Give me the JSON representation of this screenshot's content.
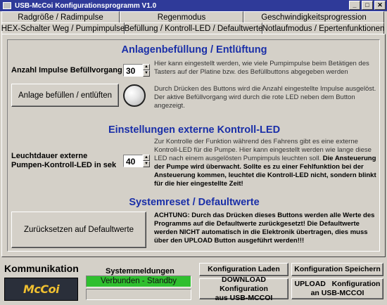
{
  "window": {
    "title": "USB-McCoi Konfigurationsprogramm V1.0"
  },
  "tabs_row1": [
    "Radgröße / Radimpulse",
    "Regenmodus",
    "Geschwindigkeitsprogression"
  ],
  "tabs_row2": [
    "HEX-Schalter Weg / Pumpimpulse",
    "Befüllung / Kontroll-LED / Defaultwerte",
    "Notlaufmodus / Epertenfunktionen"
  ],
  "section1": {
    "title": "Anlagenbefüllung / Entlüftung",
    "impulse_label": "Anzahl Impulse Befüllvorgang",
    "impulse_value": "30",
    "impulse_desc": "Hier kann eingestellt werden, wie viele Pumpimpulse beim Betätigen des Tasters auf der Platine bzw. des Befüllbuttons abgegeben werden",
    "fill_button": "Anlage befüllen / entlüften",
    "fill_desc": "Durch Drücken des Buttons wird die Anzahl eingestellte Impulse ausgelöst. Der aktive Befüllvorgang wird durch die rote LED neben dem Button angezeigt."
  },
  "section2": {
    "title": "Einstellungen externe Kontroll-LED",
    "label_line1": "Leuchtdauer externe",
    "label_line2": "Pumpen-Kontroll-LED in sek",
    "value": "40",
    "desc_normal": "Zur Kontrolle der Funktion während des Fahrens gibt es eine externe Kontroll-LED für die Pumpe. Hier kann eingestellt werden wie lange diese LED nach einem ausgelösten Pumpimpuls leuchten soll.",
    "desc_bold": "Die Ansteuerung der Pumpe wird überwacht. Sollte es zu einer Fehlfunktion bei der Ansteuerung kommen, leuchtet die Kontroll-LED nicht, sondern blinkt für die hier eingestellte Zeit!"
  },
  "section3": {
    "title": "Systemreset / Defaultwerte",
    "reset_button": "Zurücksetzen auf Defaultwerte",
    "warning": "ACHTUNG: Durch das Drücken dieses Buttons werden alle Werte des Programms auf die Defaultwerte zurückgesetzt! Die Defaultwerte werden NICHT automatisch in die Elektronik übertragen, dies muss über den UPLOAD Button ausgeführt werden!!!"
  },
  "footer": {
    "kommunikation": "Kommunikation",
    "logo_text": "McCoi",
    "systemmeldungen": "Systemmeldungen",
    "status": "Verbunden - Standby",
    "btn_load": "Konfiguration Laden",
    "btn_save": "Konfiguration Speichern",
    "btn_download_1": "DOWNLOAD Konfiguration",
    "btn_download_2": "aus USB-MCCOI",
    "btn_upload_1": "UPLOAD   Konfiguration",
    "btn_upload_2": "an USB-MCCOI"
  },
  "colors": {
    "heading": "#1a2fa8",
    "status_bg": "#2fbf2f",
    "titlebar": "#2f3a99"
  }
}
